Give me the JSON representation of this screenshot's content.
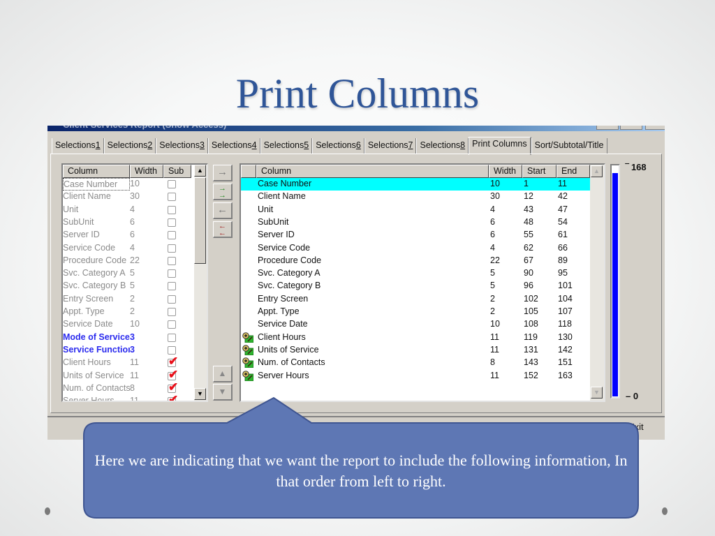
{
  "slide": {
    "title": "Print Columns",
    "callout_text": "Here we are indicating that we want the report to include the following information, In that order from left to right.",
    "callout_color": "#5e77b4"
  },
  "window": {
    "title": "Client Services Report (Show Access)",
    "tabs": [
      {
        "label": "Selections",
        "key": "1",
        "active": false
      },
      {
        "label": "Selections",
        "key": "2",
        "active": false
      },
      {
        "label": "Selections",
        "key": "3",
        "active": false
      },
      {
        "label": "Selections",
        "key": "4",
        "active": false
      },
      {
        "label": "Selections",
        "key": "5",
        "active": false
      },
      {
        "label": "Selections",
        "key": "6",
        "active": false
      },
      {
        "label": "Selections",
        "key": "7",
        "active": false
      },
      {
        "label": "Selections",
        "key": "8",
        "active": false
      },
      {
        "label": "Print Columns",
        "key": "",
        "active": true
      },
      {
        "label": "Sort/Subtotal/Title",
        "key": "",
        "active": false
      }
    ],
    "exit_label": "Exit"
  },
  "available_columns": {
    "headers": {
      "column": "Column",
      "width": "Width",
      "sub": "Sub"
    },
    "rows": [
      {
        "name": "Case Number",
        "width": "10",
        "sub": false,
        "highlight": false
      },
      {
        "name": "Client Name",
        "width": "30",
        "sub": false,
        "highlight": false
      },
      {
        "name": "Unit",
        "width": "4",
        "sub": false,
        "highlight": false
      },
      {
        "name": "SubUnit",
        "width": "6",
        "sub": false,
        "highlight": false
      },
      {
        "name": "Server ID",
        "width": "6",
        "sub": false,
        "highlight": false
      },
      {
        "name": "Service Code",
        "width": "4",
        "sub": false,
        "highlight": false
      },
      {
        "name": "Procedure Code",
        "width": "22",
        "sub": false,
        "highlight": false
      },
      {
        "name": "Svc. Category A",
        "width": "5",
        "sub": false,
        "highlight": false
      },
      {
        "name": "Svc. Category B",
        "width": "5",
        "sub": false,
        "highlight": false
      },
      {
        "name": "Entry Screen",
        "width": "2",
        "sub": false,
        "highlight": false
      },
      {
        "name": "Appt. Type",
        "width": "2",
        "sub": false,
        "highlight": false
      },
      {
        "name": "Service Date",
        "width": "10",
        "sub": false,
        "highlight": false
      },
      {
        "name": "Mode of Service",
        "width": "3",
        "sub": false,
        "highlight": true
      },
      {
        "name": "Service Function",
        "width": "3",
        "sub": false,
        "highlight": true
      },
      {
        "name": "Client Hours",
        "width": "11",
        "sub": true,
        "highlight": false
      },
      {
        "name": "Units of Service",
        "width": "11",
        "sub": true,
        "highlight": false
      },
      {
        "name": "Num. of Contacts",
        "width": "8",
        "sub": true,
        "highlight": false
      },
      {
        "name": "Server Hours",
        "width": "11",
        "sub": true,
        "highlight": false
      }
    ]
  },
  "transfer_buttons": {
    "add": "→",
    "add_all": "⇉",
    "remove": "←",
    "remove_all": "⇇",
    "move_up": "▲",
    "move_down": "▼"
  },
  "print_columns": {
    "headers": {
      "column": "Column",
      "width": "Width",
      "start": "Start",
      "end": "End"
    },
    "rows": [
      {
        "name": "Case Number",
        "width": "10",
        "start": "1",
        "end": "11",
        "selected": true,
        "icon": false
      },
      {
        "name": "Client Name",
        "width": "30",
        "start": "12",
        "end": "42",
        "selected": false,
        "icon": false
      },
      {
        "name": "Unit",
        "width": "4",
        "start": "43",
        "end": "47",
        "selected": false,
        "icon": false
      },
      {
        "name": "SubUnit",
        "width": "6",
        "start": "48",
        "end": "54",
        "selected": false,
        "icon": false
      },
      {
        "name": "Server ID",
        "width": "6",
        "start": "55",
        "end": "61",
        "selected": false,
        "icon": false
      },
      {
        "name": "Service Code",
        "width": "4",
        "start": "62",
        "end": "66",
        "selected": false,
        "icon": false
      },
      {
        "name": "Procedure Code",
        "width": "22",
        "start": "67",
        "end": "89",
        "selected": false,
        "icon": false
      },
      {
        "name": "Svc. Category A",
        "width": "5",
        "start": "90",
        "end": "95",
        "selected": false,
        "icon": false
      },
      {
        "name": "Svc. Category B",
        "width": "5",
        "start": "96",
        "end": "101",
        "selected": false,
        "icon": false
      },
      {
        "name": "Entry Screen",
        "width": "2",
        "start": "102",
        "end": "104",
        "selected": false,
        "icon": false
      },
      {
        "name": "Appt. Type",
        "width": "2",
        "start": "105",
        "end": "107",
        "selected": false,
        "icon": false
      },
      {
        "name": "Service Date",
        "width": "10",
        "start": "108",
        "end": "118",
        "selected": false,
        "icon": false
      },
      {
        "name": "Client Hours",
        "width": "11",
        "start": "119",
        "end": "130",
        "selected": false,
        "icon": true
      },
      {
        "name": "Units of Service",
        "width": "11",
        "start": "131",
        "end": "142",
        "selected": false,
        "icon": true
      },
      {
        "name": "Num. of Contacts",
        "width": "8",
        "start": "143",
        "end": "151",
        "selected": false,
        "icon": true
      },
      {
        "name": "Server Hours",
        "width": "11",
        "start": "152",
        "end": "163",
        "selected": false,
        "icon": true
      }
    ]
  },
  "width_gauge": {
    "max_label": "168",
    "min_label": "0",
    "used": 163,
    "max": 168,
    "fill_color": "#0000ff"
  }
}
